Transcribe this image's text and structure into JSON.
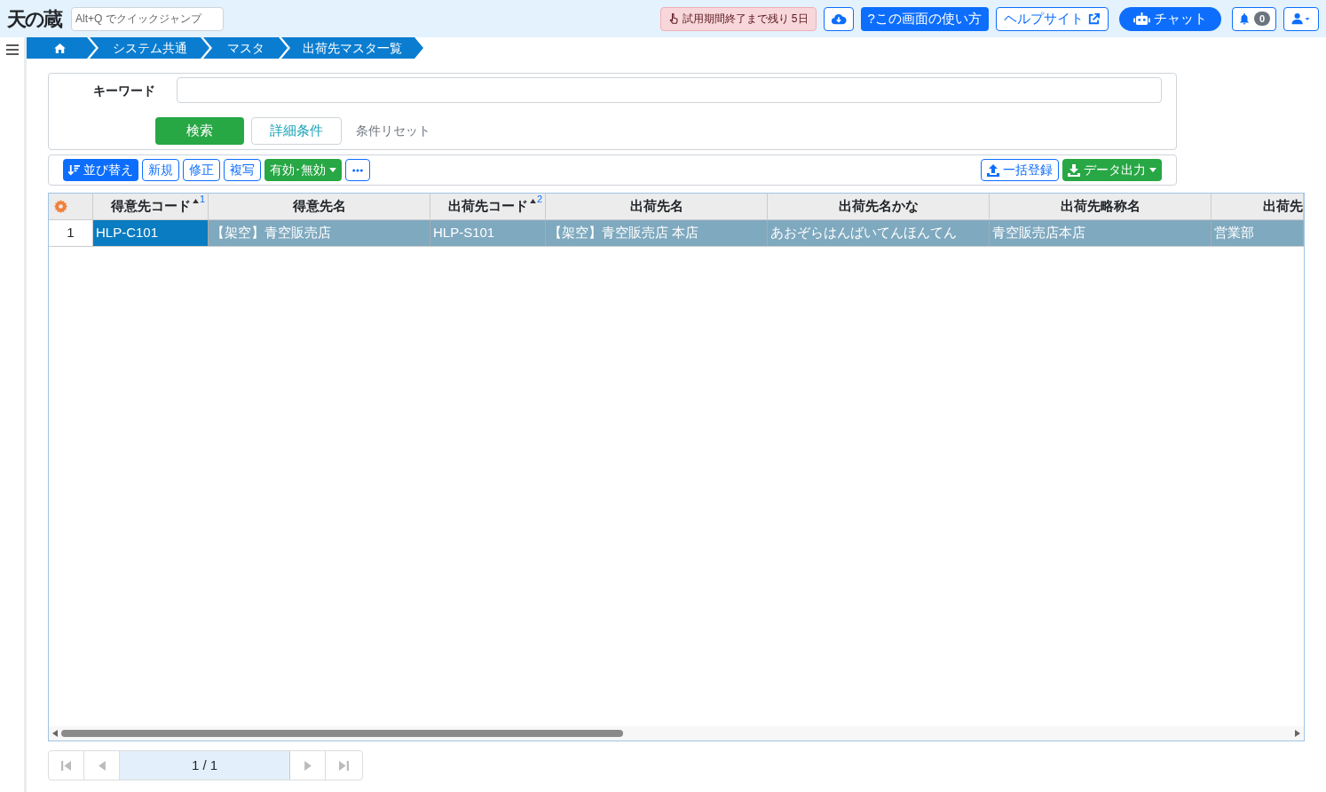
{
  "header": {
    "logo": "天の蔵",
    "quick_jump_placeholder": "Alt+Q でクイックジャンプ",
    "trial_notice": "試用期間終了まで残り 5日",
    "help_button": "?この画面の使い方",
    "help_site": "ヘルプサイト",
    "chat_button": "チャット",
    "notification_count": "0"
  },
  "breadcrumb": [
    "システム共通",
    "マスタ",
    "出荷先マスタ一覧"
  ],
  "search": {
    "keyword_label": "キーワード",
    "search_button": "検索",
    "detail_button": "詳細条件",
    "reset_link": "条件リセット"
  },
  "toolbar": {
    "left": [
      {
        "kind": "primary",
        "label": "並び替え"
      },
      {
        "kind": "outline",
        "label": "新規"
      },
      {
        "kind": "outline",
        "label": "修正"
      },
      {
        "kind": "outline",
        "label": "複写"
      },
      {
        "kind": "dropdown",
        "label": "有効･無効"
      },
      {
        "kind": "more"
      }
    ],
    "right": [
      {
        "kind": "upload",
        "label": "一括登録"
      },
      {
        "kind": "download",
        "label": "データ出力"
      }
    ]
  },
  "table": {
    "columns": [
      {
        "label": "得意先コード",
        "sort": "1"
      },
      {
        "label": "得意先名"
      },
      {
        "label": "出荷先コード",
        "sort": "2"
      },
      {
        "label": "出荷先名"
      },
      {
        "label": "出荷先名かな"
      },
      {
        "label": "出荷先略称名"
      },
      {
        "label": "出荷先"
      }
    ],
    "rows": [
      {
        "number": "1",
        "selected": true,
        "cells": [
          {
            "text": "HLP-C101",
            "focused": true
          },
          {
            "text": "【架空】青空販売店",
            "focused": false
          },
          {
            "text": "HLP-S101",
            "focused": false
          },
          {
            "text": "【架空】青空販売店 本店",
            "focused": false
          },
          {
            "text": "あおぞらはんばいてんほんてん",
            "focused": false
          },
          {
            "text": "青空販売店本店",
            "focused": false
          },
          {
            "text": "営業部",
            "focused": false
          }
        ]
      }
    ]
  },
  "pagination": {
    "page": "1 / 1"
  }
}
